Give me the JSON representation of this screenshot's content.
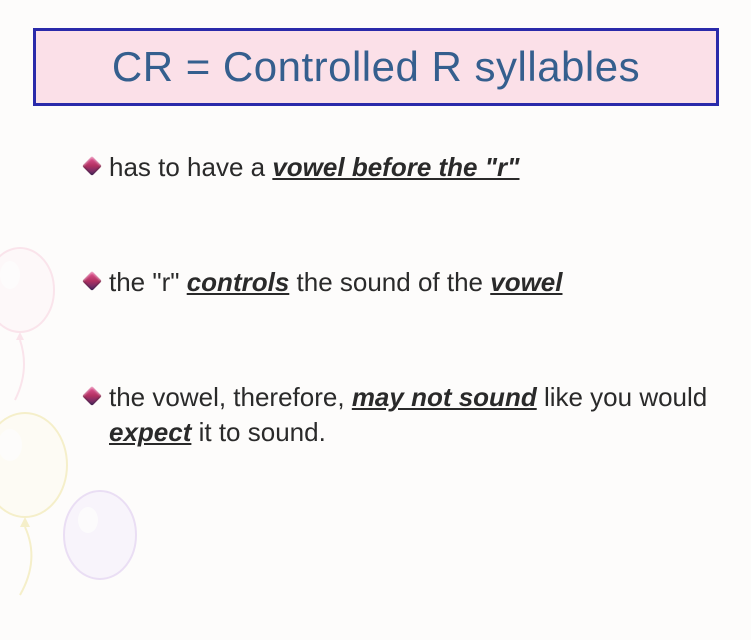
{
  "title": "CR = Controlled R syllables",
  "bullets": [
    {
      "pre1": "has to have a ",
      "emph1": "vowel before the \"r\""
    },
    {
      "pre1": "the \"r\" ",
      "emph1": "controls",
      "mid1": " the sound of the ",
      "emph2": "vowel"
    },
    {
      "pre1": "the vowel, therefore, ",
      "emph1": "may not sound",
      "mid1": " like you would ",
      "emph2": "expect",
      "post1": " it to sound."
    }
  ]
}
